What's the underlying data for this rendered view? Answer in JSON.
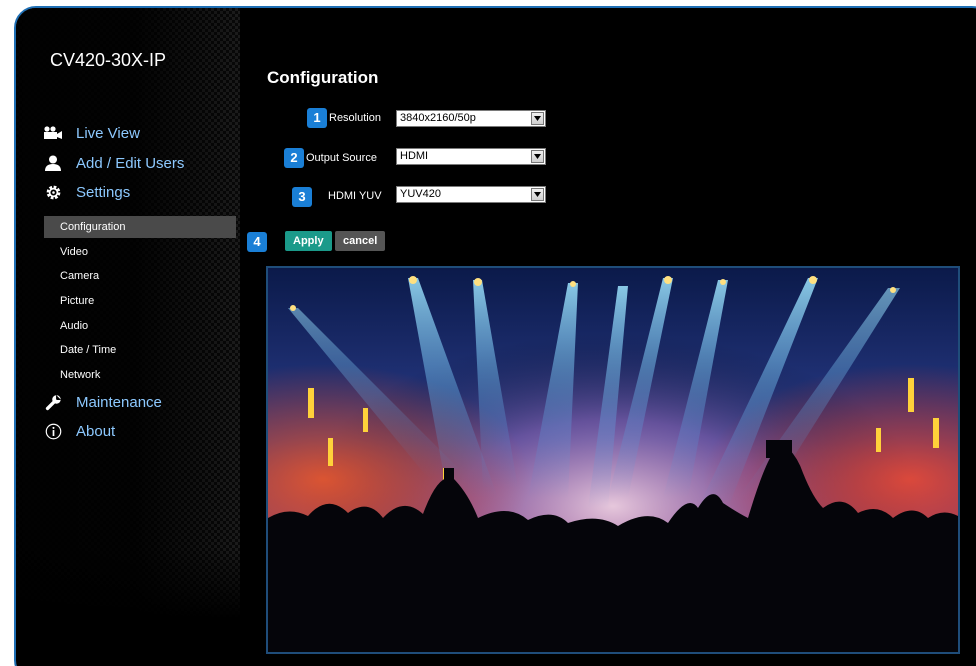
{
  "device_name": "CV420-30X-IP",
  "nav": {
    "live_view": "Live View",
    "add_edit_users": "Add / Edit Users",
    "settings": "Settings",
    "maintenance": "Maintenance",
    "about": "About"
  },
  "settings_menu": {
    "items": [
      "Configuration",
      "Video",
      "Camera",
      "Picture",
      "Audio",
      "Date / Time",
      "Network"
    ],
    "active": "Configuration"
  },
  "page_title": "Configuration",
  "fields": [
    {
      "badge": "1",
      "label": "Resolution",
      "value": "3840x2160/50p"
    },
    {
      "badge": "2",
      "label": "Output Source",
      "value": "HDMI"
    },
    {
      "badge": "3",
      "label": "HDMI YUV",
      "value": "YUV420"
    }
  ],
  "actions": {
    "badge": "4",
    "apply": "Apply",
    "cancel": "cancel"
  },
  "colors": {
    "accent": "#1a7fd6",
    "nav_text": "#8dc9ff",
    "apply_button": "#1b9a8a",
    "frame_border": "#1f6fb4"
  },
  "icons": {
    "live_view": "video-camera-icon",
    "add_edit_users": "user-icon",
    "settings": "gear-icon",
    "maintenance": "wrench-icon",
    "about": "info-icon"
  }
}
